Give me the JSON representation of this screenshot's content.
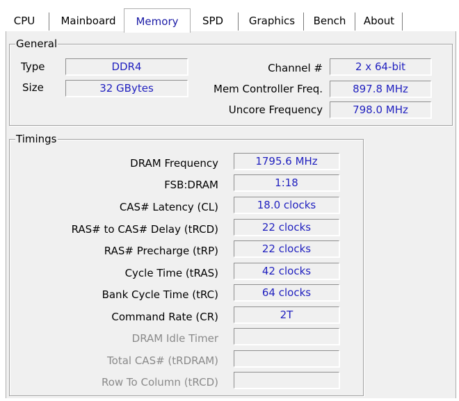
{
  "tabs": [
    "CPU",
    "Mainboard",
    "Memory",
    "SPD",
    "Graphics",
    "Bench",
    "About"
  ],
  "active_tab": "Memory",
  "general": {
    "title": "General",
    "type_label": "Type",
    "type_value": "DDR4",
    "size_label": "Size",
    "size_value": "32 GBytes",
    "channel_label": "Channel #",
    "channel_value": "2 x 64-bit",
    "mem_ctrl_label": "Mem Controller Freq.",
    "mem_ctrl_value": "897.8 MHz",
    "uncore_label": "Uncore Frequency",
    "uncore_value": "798.0 MHz"
  },
  "timings": {
    "title": "Timings",
    "rows": [
      {
        "label": "DRAM Frequency",
        "value": "1795.6 MHz",
        "disabled": false
      },
      {
        "label": "FSB:DRAM",
        "value": "1:18",
        "disabled": false
      },
      {
        "label": "CAS# Latency (CL)",
        "value": "18.0 clocks",
        "disabled": false
      },
      {
        "label": "RAS# to CAS# Delay (tRCD)",
        "value": "22 clocks",
        "disabled": false
      },
      {
        "label": "RAS# Precharge (tRP)",
        "value": "22 clocks",
        "disabled": false
      },
      {
        "label": "Cycle Time (tRAS)",
        "value": "42 clocks",
        "disabled": false
      },
      {
        "label": "Bank Cycle Time (tRC)",
        "value": "64 clocks",
        "disabled": false
      },
      {
        "label": "Command Rate (CR)",
        "value": "2T",
        "disabled": false
      },
      {
        "label": "DRAM Idle Timer",
        "value": "",
        "disabled": true
      },
      {
        "label": "Total CAS# (tRDRAM)",
        "value": "",
        "disabled": true
      },
      {
        "label": "Row To Column (tRCD)",
        "value": "",
        "disabled": true
      }
    ]
  },
  "colors": {
    "value_text": "#1f1fbf",
    "active_tab_text": "#1a1aa6",
    "panel_bg": "#f0f0f0"
  }
}
